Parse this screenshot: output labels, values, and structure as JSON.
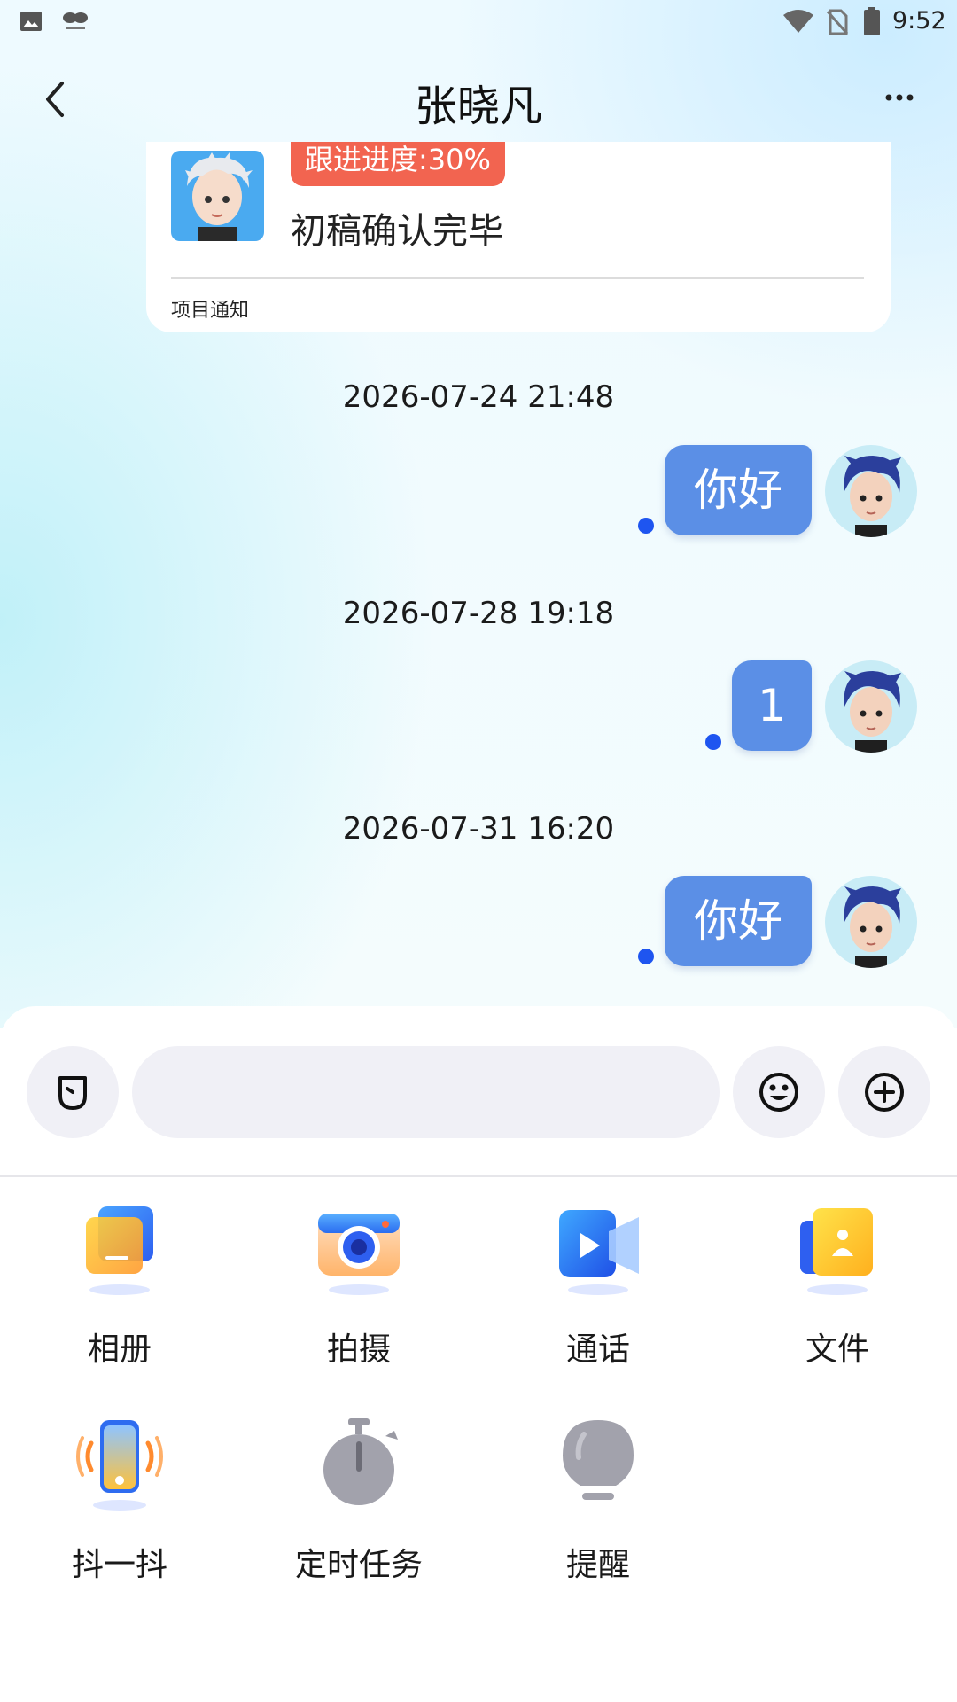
{
  "status_bar": {
    "time": "9:52"
  },
  "header": {
    "title": "张晓凡"
  },
  "project_card": {
    "progress_badge": "跟进进度:30%",
    "text": "初稿确认完毕",
    "footer": "项目通知"
  },
  "messages": [
    {
      "timestamp": "2026-07-24 21:48",
      "text": "你好"
    },
    {
      "timestamp": "2026-07-28 19:18",
      "text": "1"
    },
    {
      "timestamp": "2026-07-31 16:20",
      "text": "你好"
    }
  ],
  "input": {
    "placeholder": ""
  },
  "actions": [
    {
      "label": "相册",
      "icon": "album-icon"
    },
    {
      "label": "拍摄",
      "icon": "camera-icon"
    },
    {
      "label": "通话",
      "icon": "video-call-icon"
    },
    {
      "label": "文件",
      "icon": "file-icon"
    },
    {
      "label": "抖一抖",
      "icon": "shake-icon"
    },
    {
      "label": "定时任务",
      "icon": "timer-icon"
    },
    {
      "label": "提醒",
      "icon": "bulb-icon"
    }
  ],
  "colors": {
    "bubble": "#5b8fe6",
    "unread_dot": "#1e55f0",
    "badge": "#f26450"
  }
}
